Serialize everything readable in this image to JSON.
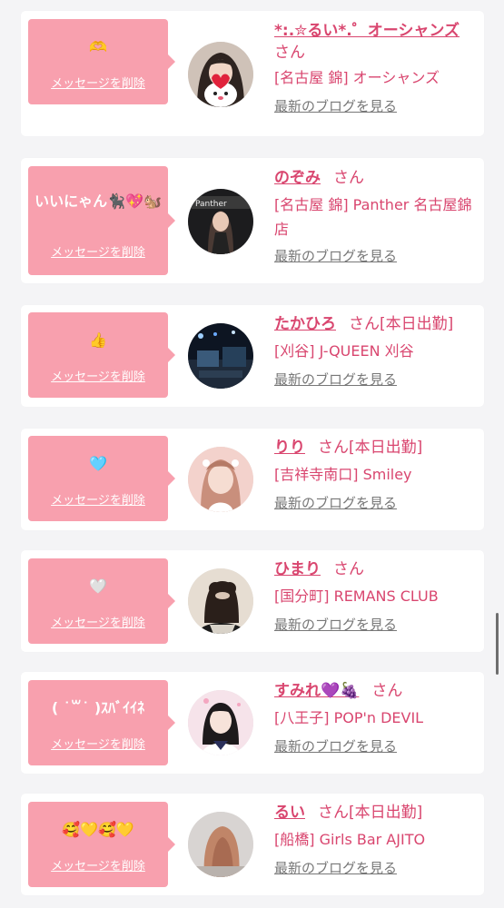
{
  "cards": [
    {
      "message": "🫶",
      "delete_label": "メッセージを削除",
      "name": "*:.✮るい*.゜オーシャンズ",
      "san": "さん",
      "status": "",
      "shop": "[名古屋 錦] オーシャンズ",
      "blog_label": "最新のブログを見る",
      "avatar": "photo-girl-strawberry-dog"
    },
    {
      "message": "いいにゃん🐈‍⬛💖🐿️",
      "delete_label": "メッセージを削除",
      "name": "のぞみ",
      "san": "さん",
      "status": "",
      "shop": "[名古屋 錦] Panther 名古屋錦店",
      "blog_label": "最新のブログを見る",
      "avatar": "photo-girl-dark"
    },
    {
      "message": "👍",
      "delete_label": "メッセージを削除",
      "name": "たかひろ",
      "san": "さん",
      "status": "[本日出勤]",
      "shop": "[刈谷] J-QUEEN 刈谷",
      "blog_label": "最新のブログを見る",
      "avatar": "photo-bar-interior"
    },
    {
      "message": "🩵",
      "delete_label": "メッセージを削除",
      "name": "りり",
      "san": "さん",
      "status": "[本日出勤]",
      "shop": "[吉祥寺南口] Smiley",
      "blog_label": "最新のブログを見る",
      "avatar": "photo-girl-pink"
    },
    {
      "message": "🤍",
      "delete_label": "メッセージを削除",
      "name": "ひまり",
      "san": "さん",
      "status": "",
      "shop": "[国分町] REMANS CLUB",
      "blog_label": "最新のブログを見る",
      "avatar": "photo-girl-back"
    },
    {
      "message": "( ˙꒳​˙ )ｽﾊﾞｲｲﾈ",
      "delete_label": "メッセージを削除",
      "name": "すみれ💜🍇",
      "san": "さん",
      "status": "",
      "shop": "[八王子] POP'n DEVIL",
      "blog_label": "最新のブログを見る",
      "avatar": "photo-girl-uniform"
    },
    {
      "message": "🥰💛🥰💛",
      "delete_label": "メッセージを削除",
      "name": "るい",
      "san": "さん",
      "status": "[本日出勤]",
      "shop": "[船橋] Girls Bar AJITO",
      "blog_label": "最新のブログを見る",
      "avatar": "photo-girl-hair"
    }
  ]
}
